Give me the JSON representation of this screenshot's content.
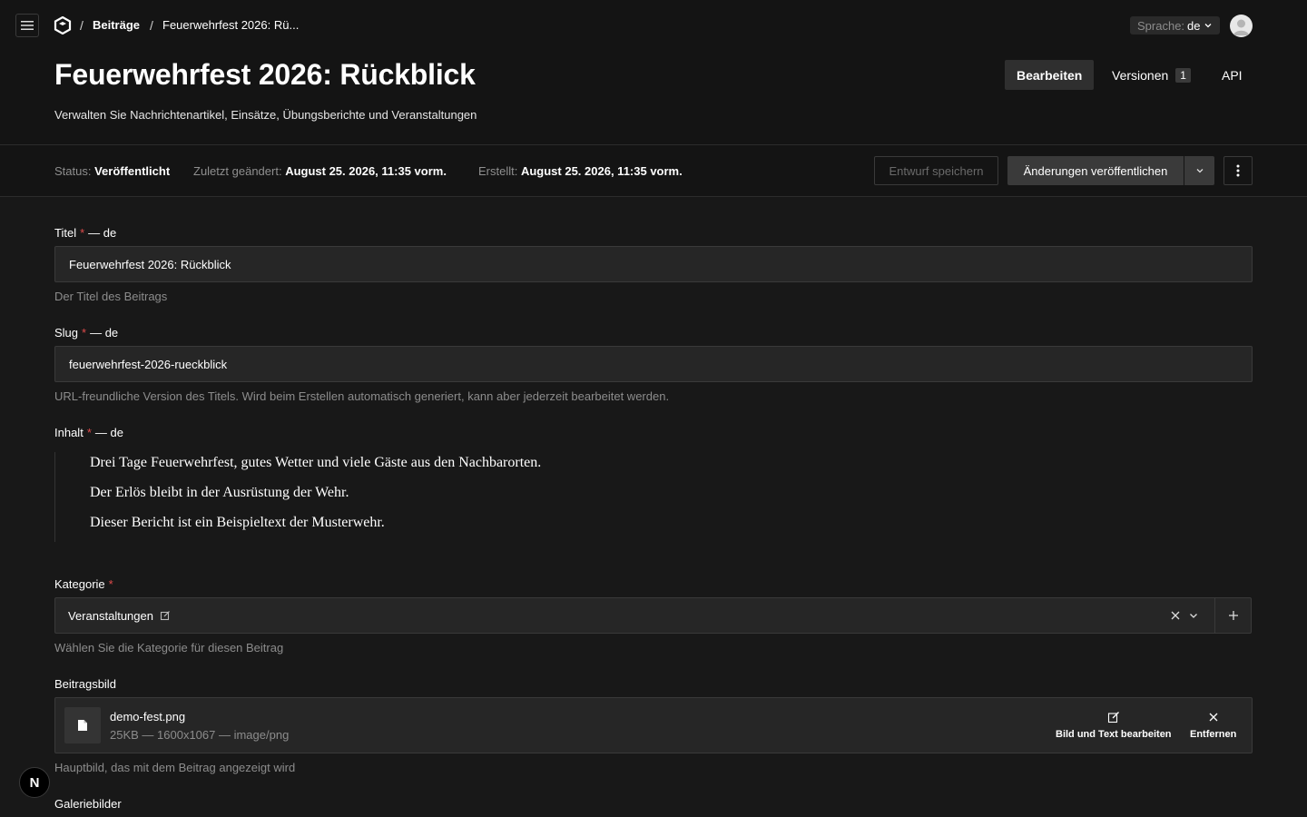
{
  "breadcrumb": {
    "section": "Beiträge",
    "current": "Feuerwehrfest 2026: Rü..."
  },
  "language": {
    "label": "Sprache:",
    "value": "de"
  },
  "header": {
    "title": "Feuerwehrfest 2026: Rückblick",
    "description": "Verwalten Sie Nachrichtenartikel, Einsätze, Übungsberichte und Veranstaltungen",
    "tabs": [
      {
        "label": "Bearbeiten",
        "active": true
      },
      {
        "label": "Versionen",
        "count": "1"
      },
      {
        "label": "API"
      }
    ]
  },
  "status": {
    "status_label": "Status:",
    "status_value": "Veröffentlicht",
    "modified_label": "Zuletzt geändert:",
    "modified_value": "August 25. 2026, 11:35 vorm.",
    "created_label": "Erstellt:",
    "created_value": "August 25. 2026, 11:35 vorm."
  },
  "actions": {
    "save_draft": "Entwurf speichern",
    "publish": "Änderungen veröffentlichen"
  },
  "fields": {
    "title": {
      "label": "Titel",
      "locale": "— de",
      "value": "Feuerwehrfest 2026: Rückblick",
      "hint": "Der Titel des Beitrags"
    },
    "slug": {
      "label": "Slug",
      "locale": "— de",
      "value": "feuerwehrfest-2026-rueckblick",
      "hint": "URL-freundliche Version des Titels. Wird beim Erstellen automatisch generiert, kann aber jederzeit bearbeitet werden."
    },
    "content": {
      "label": "Inhalt",
      "locale": "— de",
      "lines": [
        "Drei Tage Feuerwehrfest, gutes Wetter und viele Gäste aus den Nachbarorten.",
        "Der Erlös bleibt in der Ausrüstung der Wehr.",
        "Dieser Bericht ist ein Beispieltext der Musterwehr."
      ]
    },
    "category": {
      "label": "Kategorie",
      "value": "Veranstaltungen",
      "hint": "Wählen Sie die Kategorie für diesen Beitrag"
    },
    "image": {
      "label": "Beitragsbild",
      "file_name": "demo-fest.png",
      "file_meta": "25KB — 1600x1067 — image/png",
      "edit_label": "Bild und Text bearbeiten",
      "remove_label": "Entfernen",
      "hint": "Hauptbild, das mit dem Beitrag angezeigt wird"
    },
    "gallery": {
      "label": "Galeriebilder"
    }
  },
  "required_marker": "*",
  "dev_badge": "N"
}
